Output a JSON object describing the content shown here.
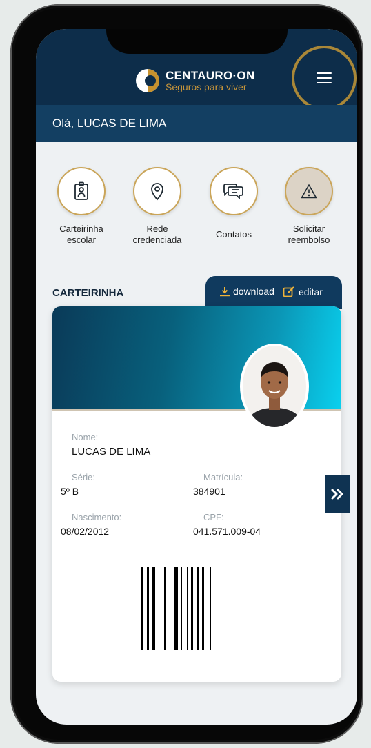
{
  "app": {
    "brand_name": "CENTAURO·ON",
    "brand_tagline": "Seguros para viver",
    "greeting": "Olá, LUCAS DE LIMA",
    "colors": {
      "navy": "#0d2d4a",
      "gold": "#c7922e",
      "accent_blue": "#0ad0ee"
    }
  },
  "shortcuts": [
    {
      "label_line1": "Carteirinha",
      "label_line2": "escolar",
      "icon": "id-badge-icon"
    },
    {
      "label_line1": "Rede",
      "label_line2": "credenciada",
      "icon": "map-pin-icon"
    },
    {
      "label_line1": "Contatos",
      "label_line2": "",
      "icon": "chat-bubbles-icon"
    },
    {
      "label_line1": "Solicitar",
      "label_line2": "reembolso",
      "icon": "warning-triangle-icon"
    }
  ],
  "card_section": {
    "title": "CARTEIRINHA",
    "download_label": "download",
    "edit_label": "editar"
  },
  "card": {
    "name_label": "Nome:",
    "name": "LUCAS DE LIMA",
    "serie_label": "Série:",
    "serie": "5º B",
    "matricula_label": "Matrícula:",
    "matricula": "384901",
    "nascimento_label": "Nascimento:",
    "nascimento": "08/02/2012",
    "cpf_label": "CPF:",
    "cpf": "041.571.009-04"
  }
}
